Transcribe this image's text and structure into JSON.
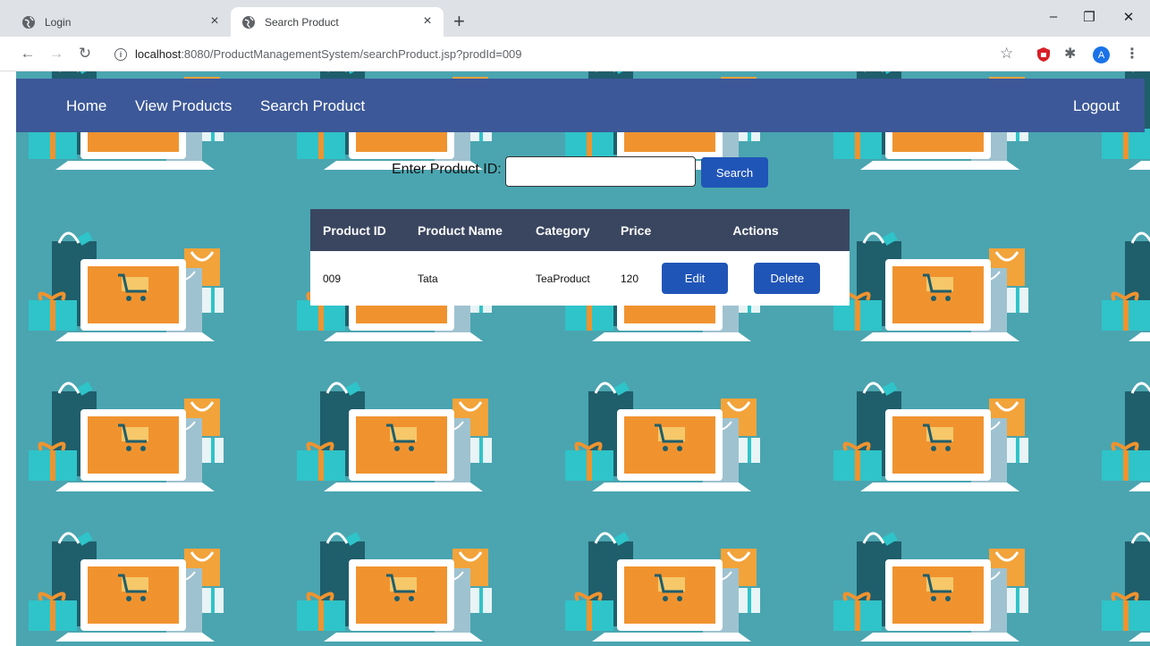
{
  "browser": {
    "tabs": [
      {
        "title": "Login",
        "active": false
      },
      {
        "title": "Search Product",
        "active": true
      }
    ],
    "url_host": "localhost",
    "url_rest": ":8080/ProductManagementSystem/searchProduct.jsp?prodId=009",
    "profile_initial": "A"
  },
  "nav": {
    "home": "Home",
    "view_products": "View Products",
    "search_product": "Search Product",
    "logout": "Logout"
  },
  "search": {
    "label": "Enter Product ID:",
    "value": "",
    "button": "Search"
  },
  "table": {
    "headers": [
      "Product ID",
      "Product Name",
      "Category",
      "Price",
      "Actions"
    ],
    "rows": [
      {
        "id": "009",
        "name": "Tata",
        "category": "TeaProduct",
        "price": "120",
        "edit": "Edit",
        "delete": "Delete"
      }
    ]
  },
  "colors": {
    "navbar": "#3c5898",
    "background": "#4aa5b0",
    "table_header": "#3a4660",
    "button": "#2055b8"
  }
}
